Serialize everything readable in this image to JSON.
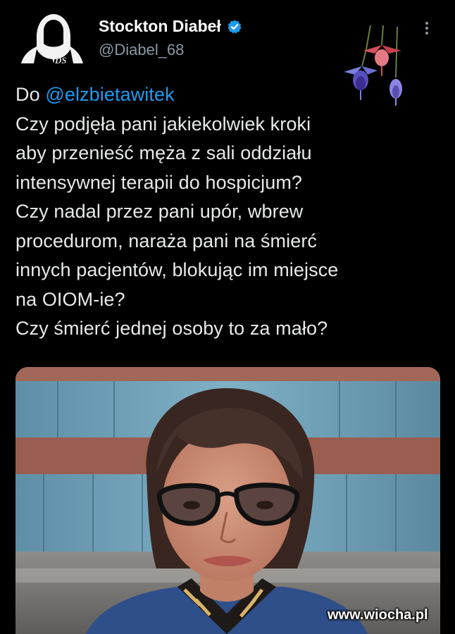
{
  "author": {
    "display_name": "Stockton Diabeł",
    "handle": "@Diabel_68",
    "avatar_initials": "DS",
    "verified": true,
    "verified_color": "#1d9bf0"
  },
  "tweet": {
    "prefix": "Do ",
    "mention": "@elzbietawitek",
    "lines": [
      "Czy podjęła pani jakiekolwiek kroki",
      "aby przenieść męża z sali oddziału",
      "intensywnej terapii do hospicjum?",
      "Czy nadal przez pani upór, wbrew",
      "procedurom, naraża pani na śmierć",
      "innych pacjentów, blokując im miejsce",
      "na OIOM-ie?",
      "Czy śmierć jednej osoby to za mało?"
    ]
  },
  "icons": {
    "more": "more-vertical-icon",
    "verified": "verified-badge-icon",
    "decoration": "fuchsia-flowers-icon"
  },
  "watermark": "www.wiocha.pl",
  "colors": {
    "background": "#000000",
    "text": "#e7e9ea",
    "handle": "#8b98a5",
    "mention": "#1d9bf0"
  }
}
